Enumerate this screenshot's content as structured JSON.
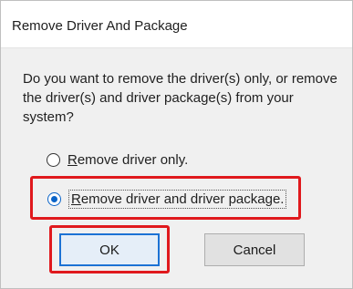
{
  "dialog": {
    "title": "Remove Driver And Package",
    "question": "Do you want to remove the driver(s) only, or remove the driver(s) and driver package(s) from your system?",
    "options": [
      {
        "accel": "R",
        "rest": "emove driver only.",
        "selected": false
      },
      {
        "accel": "R",
        "rest": "emove driver and driver package.",
        "selected": true
      }
    ],
    "ok_label": "OK",
    "cancel_label": "Cancel"
  },
  "colors": {
    "highlight": "#e0191d",
    "accent": "#0a64c8"
  }
}
